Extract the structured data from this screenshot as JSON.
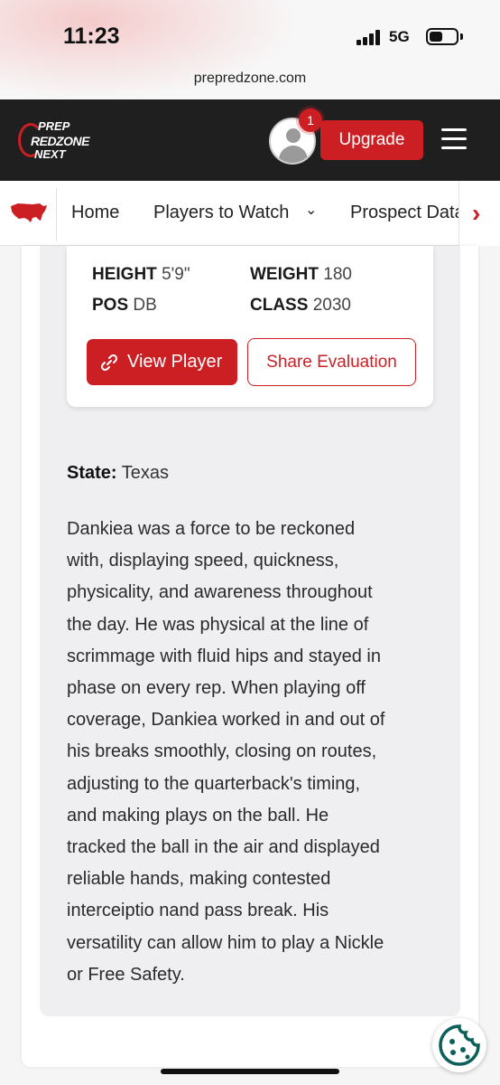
{
  "status_bar": {
    "time": "11:23",
    "network": "5G",
    "url": "prepredzone.com"
  },
  "header": {
    "logo": {
      "line1": "PREP",
      "line2": "REDZONE",
      "line3": "NEXT"
    },
    "notification_count": "1",
    "upgrade_label": "Upgrade"
  },
  "nav": {
    "items": [
      {
        "label": "Home"
      },
      {
        "label": "Players to Watch"
      },
      {
        "label": "Prospect Database"
      }
    ],
    "players_chevron": "⌄",
    "scroll_arrow": "›"
  },
  "player": {
    "height_label": "HEIGHT",
    "height": "5'9\"",
    "weight_label": "WEIGHT",
    "weight": "180",
    "pos_label": "POS",
    "pos": "DB",
    "class_label": "CLASS",
    "class": "2030",
    "view_label": "View Player",
    "share_label": "Share Evaluation"
  },
  "evaluation": {
    "state_label": "State:",
    "state": "Texas",
    "lines": [
      "Dankiea was a force to be reckoned",
      "with, displaying speed, quickness,",
      "physicality, and awareness throughout",
      "the day. He was physical at the line of",
      "scrimmage with fluid hips and stayed in",
      "phase on every rep. When playing off",
      "coverage, Dankiea worked in and out of",
      "his breaks smoothly, closing on routes,",
      "adjusting to the quarterback's timing,",
      "and making plays on the ball. He",
      "tracked the ball in the air and displayed",
      "reliable hands, making contested",
      "interceiptio nand pass break. His",
      "versatility can allow him to play a Nickle",
      "or Free Safety."
    ]
  },
  "colors": {
    "brand_red": "#cc1f24",
    "header_bg": "#1f1f1f"
  }
}
